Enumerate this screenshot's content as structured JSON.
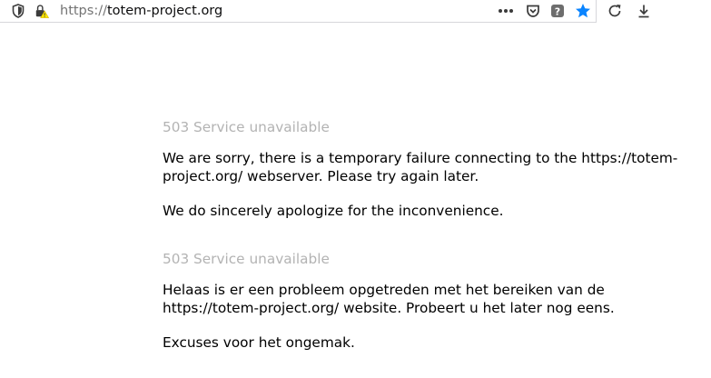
{
  "browser": {
    "url_scheme": "https://",
    "url_host": "totem-project.org",
    "icons": [
      "shield-icon",
      "lock-warning-icon",
      "more-icon",
      "pocket-icon",
      "help-icon",
      "bookmark-star-icon",
      "reload-icon",
      "download-icon"
    ],
    "accent_color": "#0a84ff"
  },
  "page": {
    "english": {
      "status": "503 Service unavailable",
      "message_line1": "We are sorry, there is a temporary failure connecting to the https://totem-",
      "message_line2": "project.org/ webserver. Please try again later.",
      "apology": "We do sincerely apologize for the inconvenience."
    },
    "dutch": {
      "status": "503 Service unavailable",
      "message_line1": "Helaas is er een probleem opgetreden met het bereiken van de",
      "message_line2": "https://totem-project.org/ website. Probeert u het later nog eens.",
      "apology": "Excuses voor het ongemak."
    }
  }
}
